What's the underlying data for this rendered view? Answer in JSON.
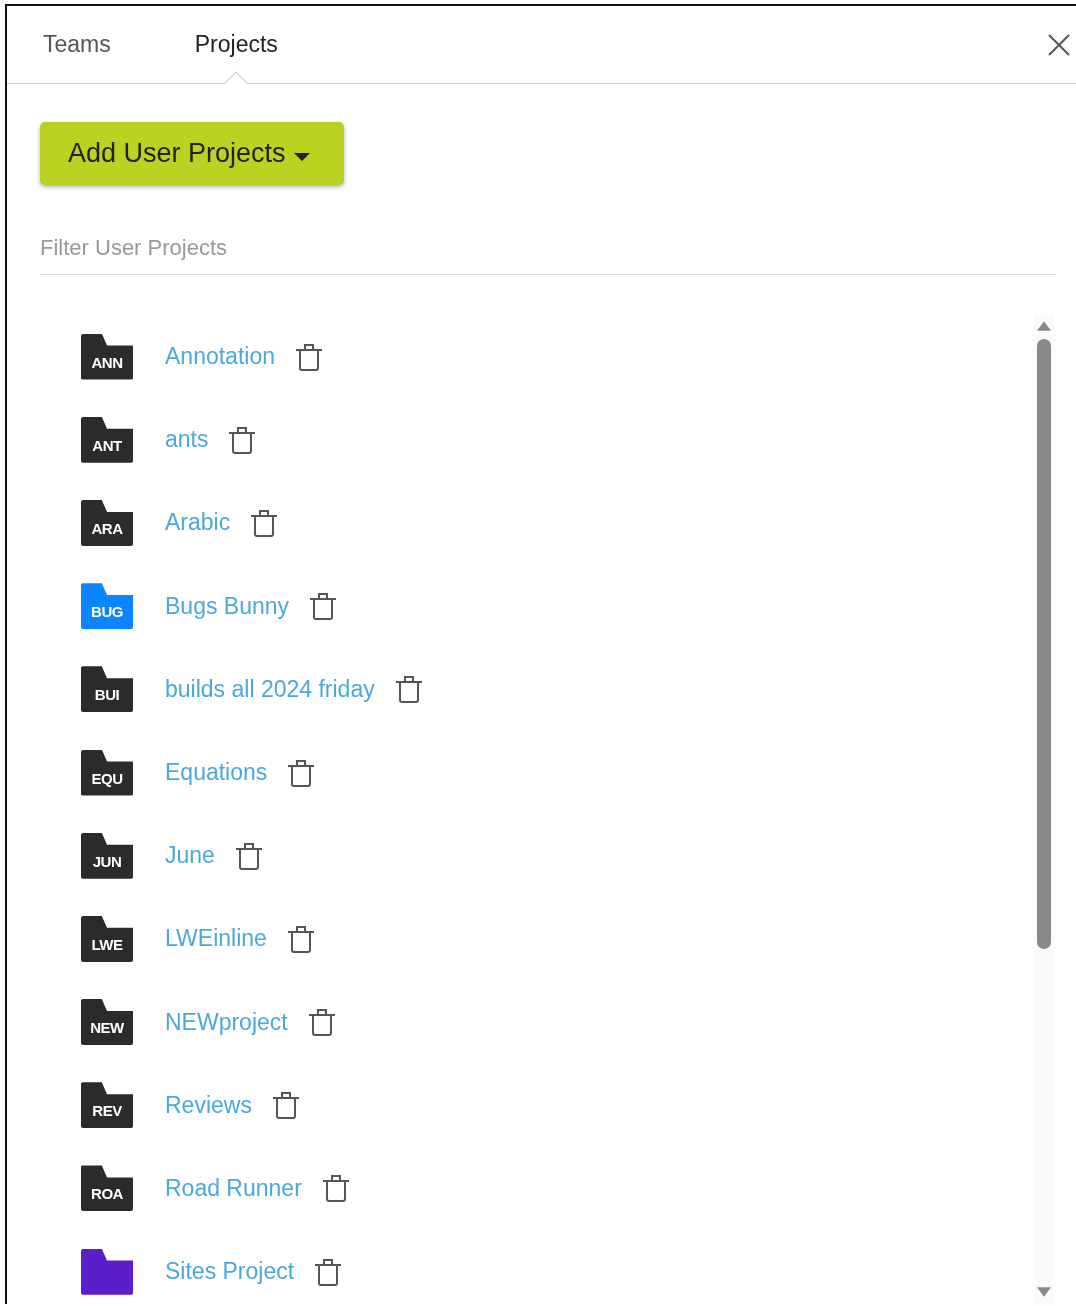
{
  "tabs": [
    {
      "label": "Teams",
      "selected": false
    },
    {
      "label": "Projects",
      "selected": true
    }
  ],
  "add_button": {
    "label": "Add User Projects"
  },
  "filter": {
    "placeholder": "Filter User Projects"
  },
  "projects": [
    {
      "badge": "ANN",
      "name": "Annotation",
      "color": "#2b2b2b"
    },
    {
      "badge": "ANT",
      "name": "ants",
      "color": "#2b2b2b"
    },
    {
      "badge": "ARA",
      "name": "Arabic",
      "color": "#2b2b2b"
    },
    {
      "badge": "BUG",
      "name": "Bugs Bunny",
      "color": "#0a84ff"
    },
    {
      "badge": "BUI",
      "name": "builds all 2024 friday",
      "color": "#2b2b2b"
    },
    {
      "badge": "EQU",
      "name": "Equations",
      "color": "#2b2b2b"
    },
    {
      "badge": "JUN",
      "name": "June",
      "color": "#2b2b2b"
    },
    {
      "badge": "LWE",
      "name": "LWEinline",
      "color": "#2b2b2b"
    },
    {
      "badge": "NEW",
      "name": "NEWproject",
      "color": "#2b2b2b"
    },
    {
      "badge": "REV",
      "name": "Reviews",
      "color": "#2b2b2b"
    },
    {
      "badge": "ROA",
      "name": "Road Runner",
      "color": "#2b2b2b"
    },
    {
      "name": "Sites Project",
      "color": "#5a1fc8"
    }
  ]
}
